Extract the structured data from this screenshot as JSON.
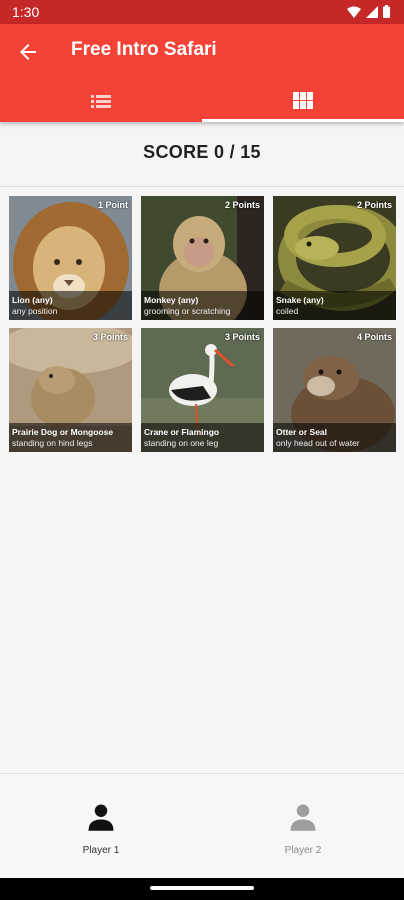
{
  "status_bar": {
    "time": "1:30"
  },
  "app_bar": {
    "title": "Free Intro Safari"
  },
  "tabs": [
    {
      "icon": "list-icon",
      "selected": false
    },
    {
      "icon": "grid-icon",
      "selected": true
    }
  ],
  "score": {
    "text": "SCORE 0 / 15"
  },
  "tiles": [
    {
      "name": "Lion (any)",
      "description": "any position",
      "points": "1 Point",
      "image": "lion"
    },
    {
      "name": "Monkey (any)",
      "description": "grooming or scratching",
      "points": "2 Points",
      "image": "monkey"
    },
    {
      "name": "Snake (any)",
      "description": "coiled",
      "points": "2 Points",
      "image": "snake"
    },
    {
      "name": "Prairie Dog or Mongoose",
      "description": "standing on hind legs",
      "points": "3 Points",
      "image": "prairie-dog"
    },
    {
      "name": "Crane or Flamingo",
      "description": "standing on one leg",
      "points": "3 Points",
      "image": "crane"
    },
    {
      "name": "Otter or Seal",
      "description": "only head out of water",
      "points": "4 Points",
      "image": "otter"
    }
  ],
  "bottom_nav": {
    "players": [
      {
        "label": "Player 1",
        "active": true
      },
      {
        "label": "Player 2",
        "active": false
      }
    ]
  },
  "colors": {
    "primary": "#f44336",
    "primary_dark": "#c62828"
  }
}
